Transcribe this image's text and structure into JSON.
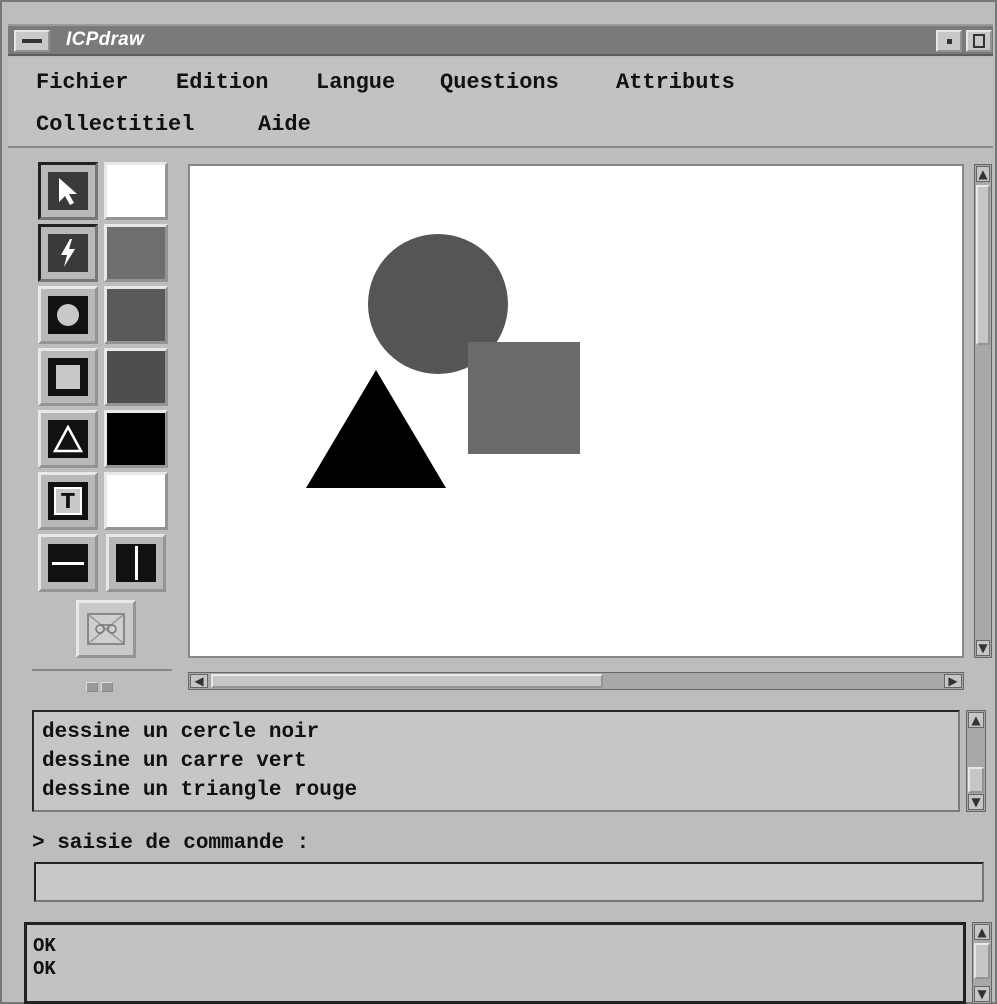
{
  "window": {
    "title": "ICPdraw"
  },
  "menu": {
    "row1": [
      "Fichier",
      "Edition",
      "Langue",
      "Questions",
      "Attributs"
    ],
    "row2": [
      "Collectitiel",
      "Aide"
    ]
  },
  "tools": {
    "select": "select-arrow-icon",
    "lightning": "lightning-icon",
    "circle": "circle-icon",
    "square": "square-icon",
    "triangle": "triangle-icon",
    "text_glyph": "T",
    "hline": "horizontal-line-icon",
    "vline": "vertical-line-icon",
    "tape": "cassette-icon"
  },
  "palette": {
    "colors": [
      "#ffffff",
      "#6e6e6e",
      "#5a5a5a",
      "#4e4e4e",
      "#000000",
      "#ffffff"
    ]
  },
  "canvas": {
    "shapes": [
      {
        "kind": "circle",
        "color": "#555555"
      },
      {
        "kind": "square",
        "color": "#6a6a6a"
      },
      {
        "kind": "triangle",
        "color": "#000000"
      }
    ]
  },
  "log": {
    "lines": [
      "dessine un cercle noir",
      "dessine un carre vert",
      "dessine un triangle rouge"
    ]
  },
  "command": {
    "prompt": "> saisie de commande :",
    "value": ""
  },
  "output": {
    "lines": [
      "OK",
      "OK"
    ]
  }
}
